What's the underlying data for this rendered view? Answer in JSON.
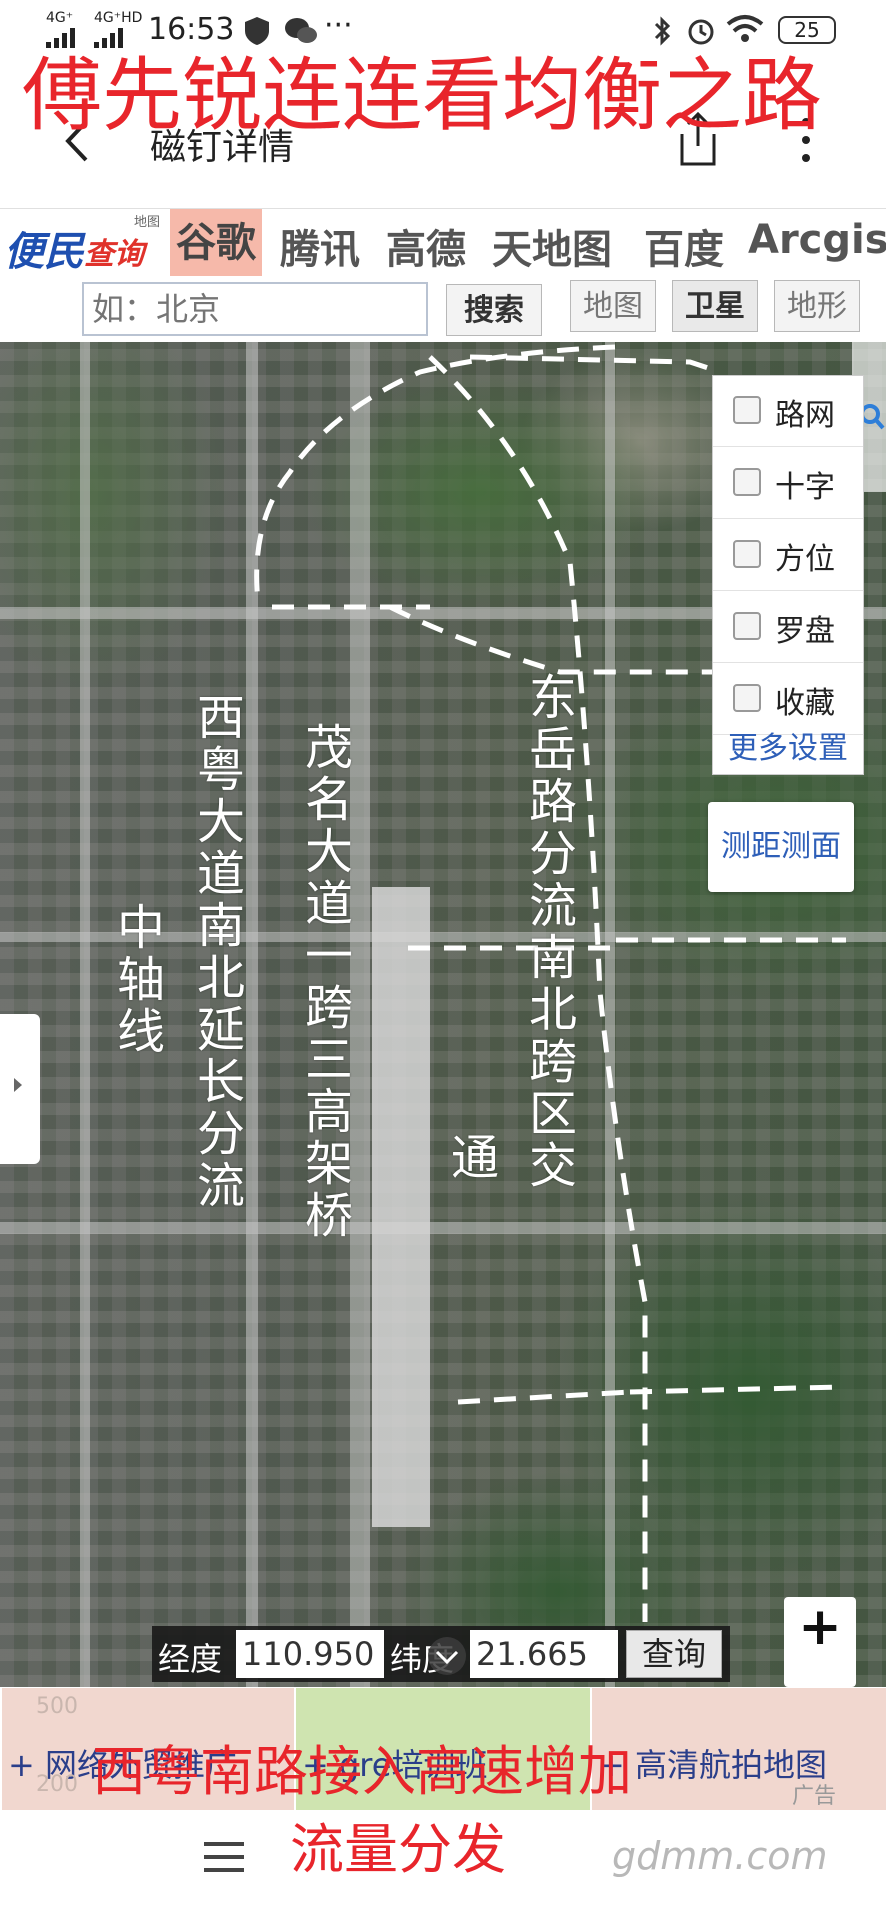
{
  "status_bar": {
    "network1": "4G⁺",
    "network2": "4G⁺HD",
    "time": "16:53",
    "dots": "···",
    "battery": "25"
  },
  "overlay_title_top": "傅先锐连连看均衡之路",
  "overlay_title_bottom_line1": "西粤南路接入高速增加",
  "overlay_title_bottom_line2": "流量分发",
  "nav": {
    "title": "磁钉详情"
  },
  "site_logo": {
    "text1": "便民",
    "text2": "查询网",
    "small": "地图"
  },
  "providers": [
    "谷歌",
    "腾讯",
    "高德",
    "天地图",
    "百度",
    "Arcgis"
  ],
  "search": {
    "placeholder": "如：北京",
    "button": "搜索",
    "map_types": [
      "地图",
      "卫星",
      "地形"
    ]
  },
  "settings_panel": {
    "items": [
      "路网",
      "十字",
      "方位",
      "罗盘",
      "收藏"
    ],
    "more": "更多设置"
  },
  "measure_button": "测距测面",
  "map_labels": {
    "label1": "西粤大道南北延长分流",
    "label2": "中轴线",
    "label3": "茂名大道一跨三高架桥",
    "label4": "东岳路分流南北跨区交",
    "label5": "通"
  },
  "zoom": {
    "plus": "+",
    "minus": "−",
    "scale": "500",
    "scale2": "200"
  },
  "coords": {
    "lon_label": "经度",
    "lon_value": "110.950",
    "lat_label": "纬度",
    "lat_value": "21.665",
    "query_button": "查询"
  },
  "ads": [
    "+ 网络外贸推广",
    "+ gre培训班",
    "+ 高清航拍地图"
  ],
  "ad_badge": "广告",
  "watermark": "gdmm.com",
  "colors": {
    "overlay_red": "#e8252b",
    "link_blue": "#2e5fb8",
    "provider_active_bg": "#f6b9aa"
  }
}
